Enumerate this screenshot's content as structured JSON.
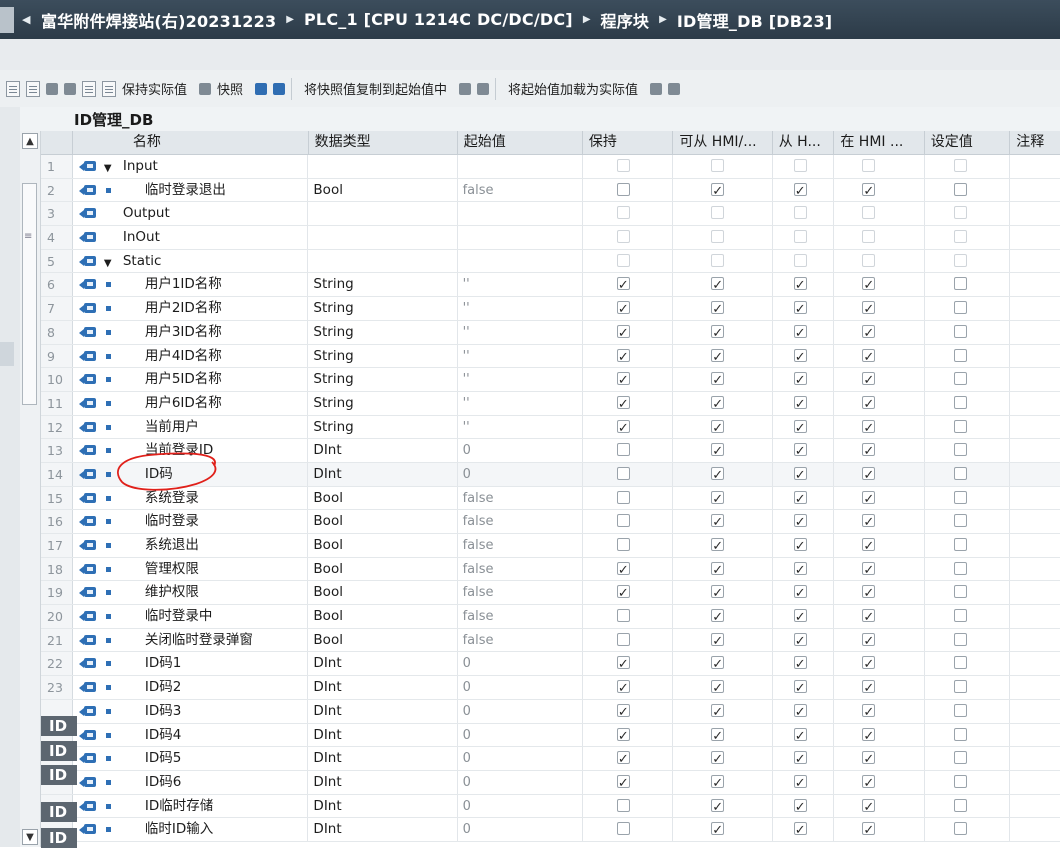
{
  "breadcrumb": {
    "project": "富华附件焊接站(右)20231223",
    "device": "PLC_1 [CPU 1214C DC/DC/DC]",
    "folder": "程序块",
    "block": "ID管理_DB [DB23]"
  },
  "toolbar": {
    "keep_actual": "保持实际值",
    "snapshot": "快照",
    "copy_snapshot": "将快照值复制到起始值中",
    "load_start": "将起始值加载为实际值"
  },
  "block_name": "ID管理_DB",
  "columns": {
    "name": "名称",
    "type": "数据类型",
    "start": "起始值",
    "retain": "保持",
    "hmi_access": "可从 HMI/...",
    "hmi_visible": "从 H...",
    "in_hmi": "在 HMI ...",
    "setpoint": "设定值",
    "comment": "注释"
  },
  "left_overflow_label": "ID",
  "rows": [
    {
      "num": "1",
      "name": "Input",
      "type": "",
      "start": "",
      "expand": true,
      "child": false,
      "retain": false,
      "hmi_access": false,
      "hmi_visible": false,
      "in_hmi": false,
      "setpoint": false,
      "dim": true
    },
    {
      "num": "2",
      "name": "临时登录退出",
      "type": "Bool",
      "start": "false",
      "child": true,
      "retain": false,
      "hmi_access": true,
      "hmi_visible": true,
      "in_hmi": true,
      "setpoint": false
    },
    {
      "num": "3",
      "name": "Output",
      "type": "",
      "start": "",
      "child": false,
      "retain": false,
      "hmi_access": false,
      "hmi_visible": false,
      "in_hmi": false,
      "setpoint": false,
      "dim": true
    },
    {
      "num": "4",
      "name": "InOut",
      "type": "",
      "start": "",
      "child": false,
      "retain": false,
      "hmi_access": false,
      "hmi_visible": false,
      "in_hmi": false,
      "setpoint": false,
      "dim": true
    },
    {
      "num": "5",
      "name": "Static",
      "type": "",
      "start": "",
      "expand": true,
      "child": false,
      "retain": false,
      "hmi_access": false,
      "hmi_visible": false,
      "in_hmi": false,
      "setpoint": false,
      "dim": true
    },
    {
      "num": "6",
      "name": "用户1ID名称",
      "type": "String",
      "start": "''",
      "child": true,
      "retain": true,
      "hmi_access": true,
      "hmi_visible": true,
      "in_hmi": true,
      "setpoint": false
    },
    {
      "num": "7",
      "name": "用户2ID名称",
      "type": "String",
      "start": "''",
      "child": true,
      "retain": true,
      "hmi_access": true,
      "hmi_visible": true,
      "in_hmi": true,
      "setpoint": false
    },
    {
      "num": "8",
      "name": "用户3ID名称",
      "type": "String",
      "start": "''",
      "child": true,
      "retain": true,
      "hmi_access": true,
      "hmi_visible": true,
      "in_hmi": true,
      "setpoint": false
    },
    {
      "num": "9",
      "name": "用户4ID名称",
      "type": "String",
      "start": "''",
      "child": true,
      "retain": true,
      "hmi_access": true,
      "hmi_visible": true,
      "in_hmi": true,
      "setpoint": false
    },
    {
      "num": "10",
      "name": "用户5ID名称",
      "type": "String",
      "start": "''",
      "child": true,
      "retain": true,
      "hmi_access": true,
      "hmi_visible": true,
      "in_hmi": true,
      "setpoint": false
    },
    {
      "num": "11",
      "name": "用户6ID名称",
      "type": "String",
      "start": "''",
      "child": true,
      "retain": true,
      "hmi_access": true,
      "hmi_visible": true,
      "in_hmi": true,
      "setpoint": false
    },
    {
      "num": "12",
      "name": "当前用户",
      "type": "String",
      "start": "''",
      "child": true,
      "retain": true,
      "hmi_access": true,
      "hmi_visible": true,
      "in_hmi": true,
      "setpoint": false
    },
    {
      "num": "13",
      "name": "当前登录ID",
      "type": "DInt",
      "start": "0",
      "child": true,
      "retain": false,
      "hmi_access": true,
      "hmi_visible": true,
      "in_hmi": true,
      "setpoint": false
    },
    {
      "num": "14",
      "name": "ID码",
      "type": "DInt",
      "start": "0",
      "child": true,
      "retain": false,
      "hmi_access": true,
      "hmi_visible": true,
      "in_hmi": true,
      "setpoint": false,
      "selected": true
    },
    {
      "num": "15",
      "name": "系统登录",
      "type": "Bool",
      "start": "false",
      "child": true,
      "retain": false,
      "hmi_access": true,
      "hmi_visible": true,
      "in_hmi": true,
      "setpoint": false
    },
    {
      "num": "16",
      "name": "临时登录",
      "type": "Bool",
      "start": "false",
      "child": true,
      "retain": false,
      "hmi_access": true,
      "hmi_visible": true,
      "in_hmi": true,
      "setpoint": false
    },
    {
      "num": "17",
      "name": "系统退出",
      "type": "Bool",
      "start": "false",
      "child": true,
      "retain": false,
      "hmi_access": true,
      "hmi_visible": true,
      "in_hmi": true,
      "setpoint": false
    },
    {
      "num": "18",
      "name": "管理权限",
      "type": "Bool",
      "start": "false",
      "child": true,
      "retain": true,
      "hmi_access": true,
      "hmi_visible": true,
      "in_hmi": true,
      "setpoint": false
    },
    {
      "num": "19",
      "name": "维护权限",
      "type": "Bool",
      "start": "false",
      "child": true,
      "retain": true,
      "hmi_access": true,
      "hmi_visible": true,
      "in_hmi": true,
      "setpoint": false
    },
    {
      "num": "20",
      "name": "临时登录中",
      "type": "Bool",
      "start": "false",
      "child": true,
      "retain": false,
      "hmi_access": true,
      "hmi_visible": true,
      "in_hmi": true,
      "setpoint": false
    },
    {
      "num": "21",
      "name": "关闭临时登录弹窗",
      "type": "Bool",
      "start": "false",
      "child": true,
      "retain": false,
      "hmi_access": true,
      "hmi_visible": true,
      "in_hmi": true,
      "setpoint": false
    },
    {
      "num": "22",
      "name": "ID码1",
      "type": "DInt",
      "start": "0",
      "child": true,
      "retain": true,
      "hmi_access": true,
      "hmi_visible": true,
      "in_hmi": true,
      "setpoint": false
    },
    {
      "num": "23",
      "name": "ID码2",
      "type": "DInt",
      "start": "0",
      "child": true,
      "retain": true,
      "hmi_access": true,
      "hmi_visible": true,
      "in_hmi": true,
      "setpoint": false
    },
    {
      "num": "",
      "name": "ID码3",
      "type": "DInt",
      "start": "0",
      "child": true,
      "retain": true,
      "hmi_access": true,
      "hmi_visible": true,
      "in_hmi": true,
      "setpoint": false
    },
    {
      "num": "",
      "name": "ID码4",
      "type": "DInt",
      "start": "0",
      "child": true,
      "retain": true,
      "hmi_access": true,
      "hmi_visible": true,
      "in_hmi": true,
      "setpoint": false
    },
    {
      "num": "",
      "name": "ID码5",
      "type": "DInt",
      "start": "0",
      "child": true,
      "retain": true,
      "hmi_access": true,
      "hmi_visible": true,
      "in_hmi": true,
      "setpoint": false
    },
    {
      "num": "",
      "name": "ID码6",
      "type": "DInt",
      "start": "0",
      "child": true,
      "retain": true,
      "hmi_access": true,
      "hmi_visible": true,
      "in_hmi": true,
      "setpoint": false
    },
    {
      "num": "",
      "name": "ID临时存储",
      "type": "DInt",
      "start": "0",
      "child": true,
      "retain": false,
      "hmi_access": true,
      "hmi_visible": true,
      "in_hmi": true,
      "setpoint": false
    },
    {
      "num": "",
      "name": "临时ID输入",
      "type": "DInt",
      "start": "0",
      "child": true,
      "retain": false,
      "hmi_access": true,
      "hmi_visible": true,
      "in_hmi": true,
      "setpoint": false
    }
  ],
  "colors": {
    "title_bg": "#2c3b48",
    "accent": "#2e6fb5",
    "annotation": "#e0201a"
  }
}
